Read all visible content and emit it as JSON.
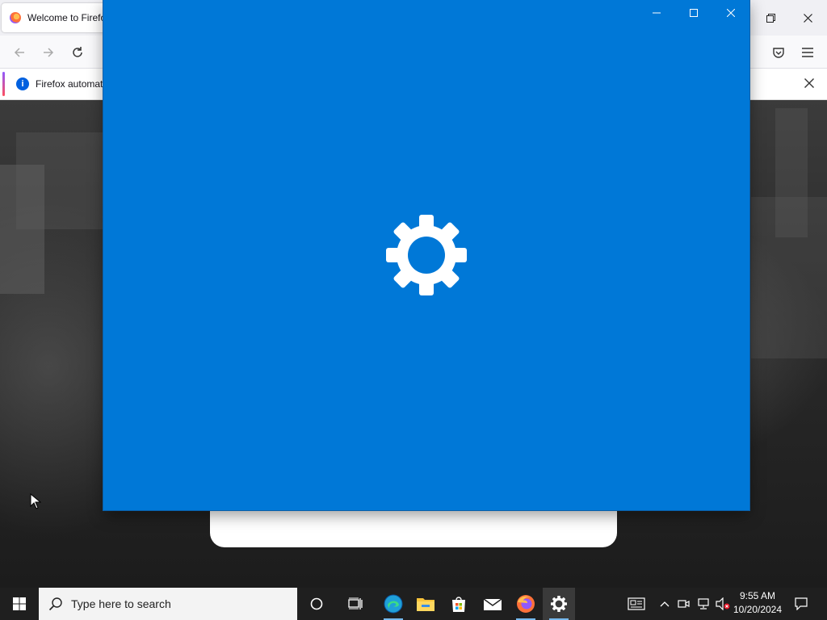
{
  "firefox": {
    "tab_title": "Welcome to Firefo",
    "notice_text": "Firefox automat"
  },
  "settings_splash": {
    "background_color": "#0078d7",
    "icon": "gear-icon"
  },
  "taskbar": {
    "search_placeholder": "Type here to search",
    "time": "9:55 AM",
    "date": "10/20/2024",
    "pinned": [
      "cortana-icon",
      "task-view-icon",
      "edge-icon",
      "file-explorer-icon",
      "microsoft-store-icon",
      "mail-icon",
      "firefox-icon",
      "settings-icon"
    ]
  }
}
